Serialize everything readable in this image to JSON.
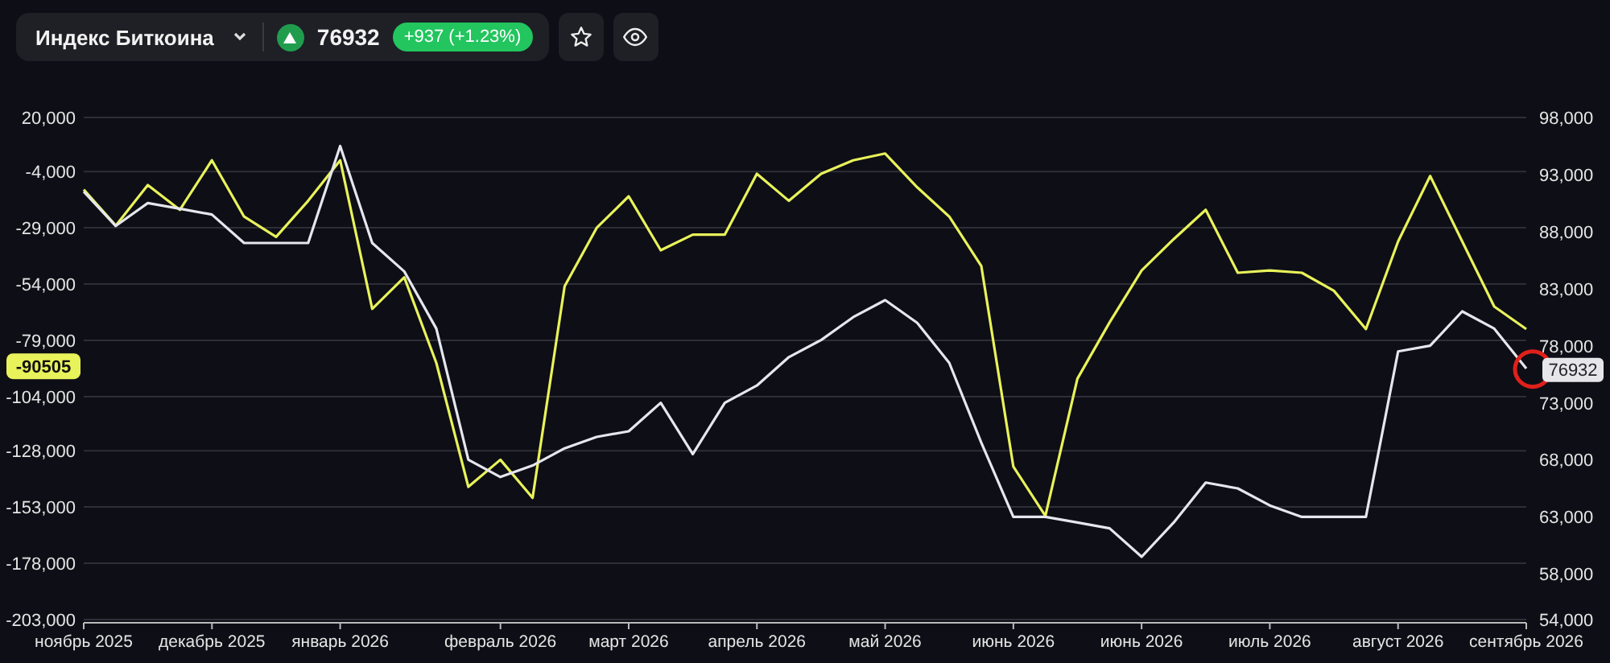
{
  "header": {
    "instrument": "Индекс Биткоина",
    "price": "76932",
    "up": true,
    "change": "+937 (+1.23%)"
  },
  "chart": {
    "left_marker": "-90505",
    "right_marker": "76932",
    "chart_data": {
      "type": "line",
      "grid": true,
      "ylim": [
        -203000,
        20000
      ],
      "y2lim": [
        54000,
        98000
      ],
      "yticks": [
        {
          "value": 20000,
          "label": "20,000"
        },
        {
          "value": -4000,
          "label": "-4,000"
        },
        {
          "value": -29000,
          "label": "-29,000"
        },
        {
          "value": -54000,
          "label": "-54,000"
        },
        {
          "value": -79000,
          "label": "-79,000"
        },
        {
          "value": -104000,
          "label": "-104,000"
        },
        {
          "value": -128000,
          "label": "-128,000"
        },
        {
          "value": -153000,
          "label": "-153,000"
        },
        {
          "value": -178000,
          "label": "-178,000"
        },
        {
          "value": -203000,
          "label": "-203,000"
        }
      ],
      "y2ticks": [
        {
          "value": 98000,
          "label": "98,000"
        },
        {
          "value": 93000,
          "label": "93,000"
        },
        {
          "value": 88000,
          "label": "88,000"
        },
        {
          "value": 83000,
          "label": "83,000"
        },
        {
          "value": 78000,
          "label": "78,000"
        },
        {
          "value": 73000,
          "label": "73,000"
        },
        {
          "value": 68000,
          "label": "68,000"
        },
        {
          "value": 63000,
          "label": "63,000"
        },
        {
          "value": 58000,
          "label": "58,000"
        },
        {
          "value": 54000,
          "label": "54,000"
        }
      ],
      "categories": [
        "ноябрь 2025",
        null,
        null,
        null,
        "декабрь 2025",
        null,
        null,
        null,
        "январь 2026",
        null,
        null,
        null,
        null,
        "февраль 2026",
        null,
        null,
        null,
        "март 2026",
        null,
        null,
        null,
        "апрель 2026",
        null,
        null,
        null,
        "май 2026",
        null,
        null,
        null,
        "июнь 2026",
        null,
        null,
        null,
        "июнь 2026",
        null,
        null,
        null,
        "июль 2026",
        null,
        null,
        null,
        "август 2026",
        null,
        null,
        null,
        "сентябрь 2026"
      ],
      "series": [
        {
          "color": "#e8f25a",
          "values": [
            -12000,
            -28000,
            -10000,
            -21000,
            1000,
            -24000,
            -33000,
            -17000,
            1000,
            -65000,
            -51000,
            -89000,
            -144000,
            -132000,
            -149000,
            -55000,
            -29000,
            -15000,
            -39000,
            -32000,
            -32000,
            -5000,
            -17000,
            -5000,
            1000,
            4000,
            -11000,
            -24000,
            -46000,
            -135000,
            -157000,
            -96000,
            -71000,
            -48000,
            -34000,
            -21000,
            -49000,
            -48000,
            -49000,
            -57000,
            -74000,
            -35000,
            -6000,
            -35000,
            -64000,
            -74000
          ]
        },
        {
          "color": "#e6e6ee",
          "axis": "y2",
          "values": [
            91500,
            88500,
            90500,
            90000,
            89500,
            87000,
            87000,
            87000,
            95500,
            87000,
            84500,
            79500,
            68000,
            66500,
            67500,
            69000,
            70000,
            70500,
            73000,
            68500,
            73000,
            74500,
            77000,
            78500,
            80500,
            82000,
            80000,
            76500,
            69500,
            63000,
            63000,
            62500,
            62000,
            59500,
            62500,
            66000,
            65500,
            64000,
            63000,
            63000,
            63000,
            77500,
            78000,
            81000,
            79500,
            76000
          ]
        }
      ]
    }
  }
}
